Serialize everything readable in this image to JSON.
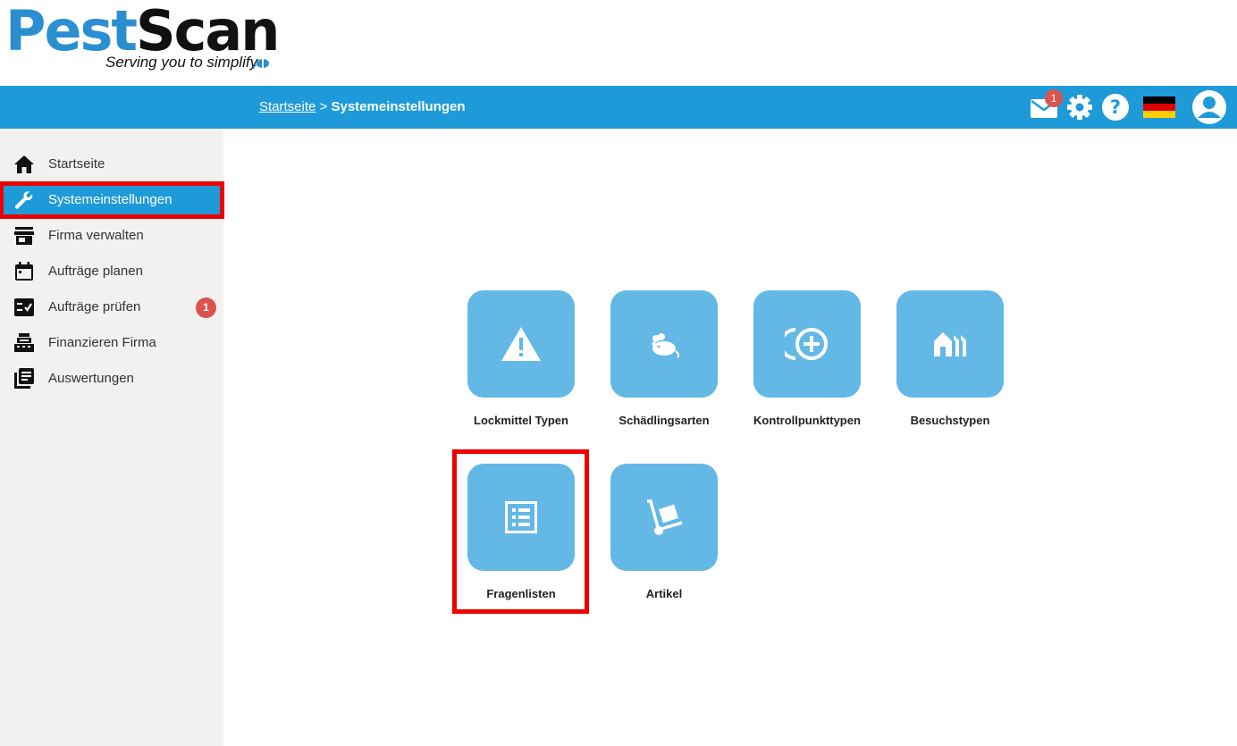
{
  "header": {
    "logo": {
      "part1": "Pest",
      "part2": "Scan",
      "tagline": "Serving you to simplify"
    }
  },
  "topbar": {
    "breadcrumb": {
      "home": "Startseite",
      "separator": ">",
      "current": "Systemeinstellungen"
    },
    "mail_badge": "1",
    "icons": [
      "mail-icon",
      "gear-icon",
      "help-icon",
      "german-flag-icon",
      "user-avatar-icon"
    ]
  },
  "sidebar": {
    "items": [
      {
        "label": "Startseite",
        "icon": "home-icon"
      },
      {
        "label": "Systemeinstellungen",
        "icon": "wrench-icon",
        "active": true
      },
      {
        "label": "Firma verwalten",
        "icon": "store-icon"
      },
      {
        "label": "Aufträge planen",
        "icon": "calendar-icon"
      },
      {
        "label": "Aufträge prüfen",
        "icon": "checklist-icon",
        "badge": "1"
      },
      {
        "label": "Finanzieren Firma",
        "icon": "cash-register-icon"
      },
      {
        "label": "Auswertungen",
        "icon": "library-icon"
      }
    ]
  },
  "tiles": [
    {
      "label": "Lockmittel Typen",
      "icon": "warning-icon"
    },
    {
      "label": "Schädlingsarten",
      "icon": "mouse-icon"
    },
    {
      "label": "Kontrollpunkttypen",
      "icon": "add-circle-icon"
    },
    {
      "label": "Besuchstypen",
      "icon": "houses-icon"
    },
    {
      "label": "Fragenlisten",
      "icon": "list-icon"
    },
    {
      "label": "Artikel",
      "icon": "hand-truck-icon"
    }
  ],
  "colors": {
    "primary": "#1f9ad8",
    "tile": "#63b8e6",
    "highlight": "#ee0000",
    "badge": "#d9534f",
    "sidebar": "#f2f1f0"
  }
}
